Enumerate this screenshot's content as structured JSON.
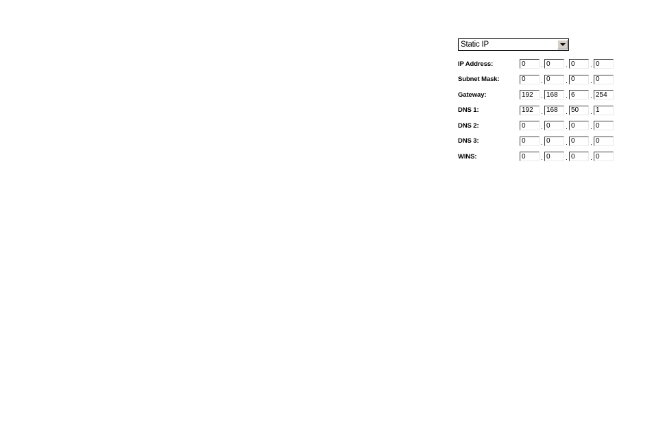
{
  "panel": {
    "name": "ip-configuration-panel",
    "connection_type": {
      "label": "Static IP",
      "selected": "Static IP",
      "arrow_icon": "chevron-down-icon"
    },
    "separator": ".",
    "fields": [
      {
        "key": "ip_address",
        "label": "IP Address:",
        "octets": [
          "0",
          "0",
          "0",
          "0"
        ]
      },
      {
        "key": "subnet_mask",
        "label": "Subnet Mask:",
        "octets": [
          "0",
          "0",
          "0",
          "0"
        ]
      },
      {
        "key": "gateway",
        "label": "Gateway:",
        "octets": [
          "192",
          "168",
          "6",
          "254"
        ]
      },
      {
        "key": "dns_1",
        "label": "DNS 1:",
        "octets": [
          "192",
          "168",
          "50",
          "1"
        ]
      },
      {
        "key": "dns_2",
        "label": "DNS 2:",
        "octets": [
          "0",
          "0",
          "0",
          "0"
        ]
      },
      {
        "key": "dns_3",
        "label": "DNS 3:",
        "octets": [
          "0",
          "0",
          "0",
          "0"
        ]
      },
      {
        "key": "wins",
        "label": "WINS:",
        "octets": [
          "0",
          "0",
          "0",
          "0"
        ]
      }
    ]
  },
  "colors": {
    "background": "#ffffff",
    "text": "#000000",
    "field_border_dark": "#3a3a3a",
    "field_border_light": "#e8e8e8",
    "button_face": "#d4d0c8"
  }
}
